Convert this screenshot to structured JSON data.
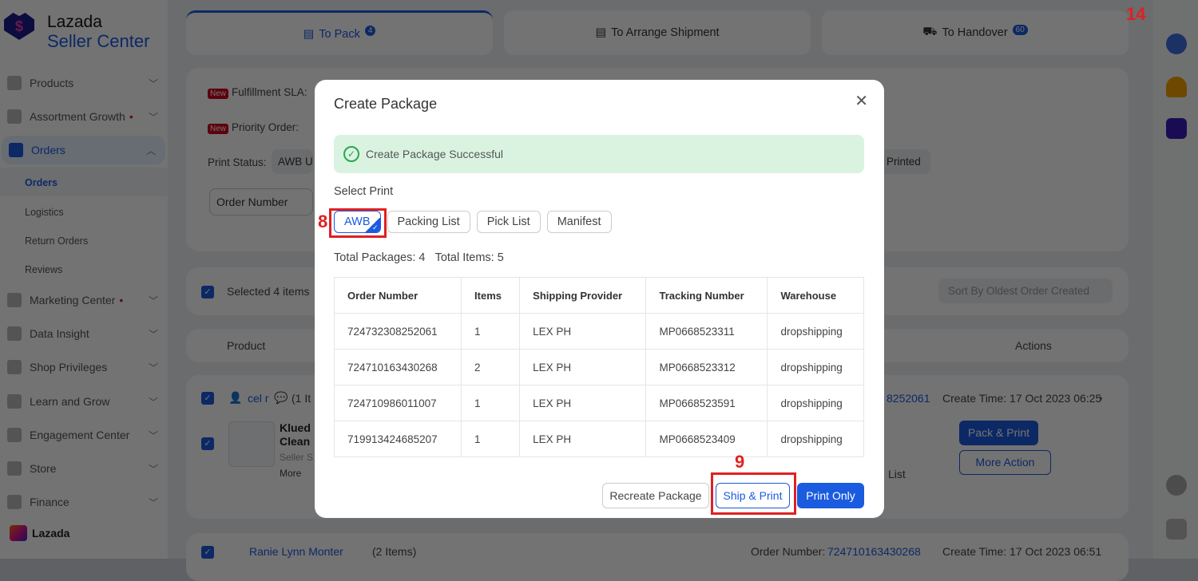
{
  "brand": {
    "line1": "Lazada",
    "line2": "Seller Center",
    "footer": "Lazada"
  },
  "sidebar": {
    "items": [
      {
        "label": "Products"
      },
      {
        "label": "Assortment Growth"
      },
      {
        "label": "Orders"
      },
      {
        "label": "Marketing Center"
      },
      {
        "label": "Data Insight"
      },
      {
        "label": "Shop Privileges"
      },
      {
        "label": "Learn and Grow"
      },
      {
        "label": "Engagement Center"
      },
      {
        "label": "Store"
      },
      {
        "label": "Finance"
      }
    ],
    "sub_items": [
      "Orders",
      "Logistics",
      "Return Orders",
      "Reviews"
    ]
  },
  "tabs": [
    {
      "label": "To Pack",
      "count": "4"
    },
    {
      "label": "To Arrange Shipment"
    },
    {
      "label": "To Handover",
      "count": "60"
    }
  ],
  "filters": {
    "new_tag": "New",
    "sla": "Fulfillment SLA:",
    "priority": "Priority Order:",
    "print_status": "Print Status:",
    "awb_chip": "AWB U",
    "printed_chip": "Printed",
    "order_number": "Order Number"
  },
  "list": {
    "selected": "Selected 4 items",
    "sort": "Sort By  Oldest Order Created",
    "col_product": "Product",
    "col_actions": "Actions",
    "order1": {
      "buyer": "cel r",
      "items": "(1 It",
      "product1": "Klued",
      "product2": "Clean",
      "seller": "Seller S",
      "more": "More",
      "order_no": "8252061",
      "create_time": "Create Time: 17 Oct 2023 06:25",
      "pack_print": "Pack & Print",
      "more_action": "More Action",
      "list_frag": "List"
    },
    "order2": {
      "buyer": "Ranie Lynn Monter",
      "items": "(2 Items)",
      "order_label": "Order Number:",
      "order_no": "724710163430268",
      "create_time": "Create Time: 17 Oct 2023 06:51"
    }
  },
  "modal": {
    "title": "Create Package",
    "success": "Create Package Successful",
    "select_print": "Select Print",
    "options": [
      "AWB",
      "Packing List",
      "Pick List",
      "Manifest"
    ],
    "total_packages": "Total Packages: 4",
    "total_items": "Total Items: 5",
    "columns": [
      "Order Number",
      "Items",
      "Shipping Provider",
      "Tracking Number",
      "Warehouse"
    ],
    "rows": [
      [
        "724732308252061",
        "1",
        "LEX PH",
        "MP0668523311",
        "dropshipping"
      ],
      [
        "724710163430268",
        "2",
        "LEX PH",
        "MP0668523312",
        "dropshipping"
      ],
      [
        "724710986011007",
        "1",
        "LEX PH",
        "MP0668523591",
        "dropshipping"
      ],
      [
        "719913424685207",
        "1",
        "LEX PH",
        "MP0668523409",
        "dropshipping"
      ]
    ],
    "recreate": "Recreate Package",
    "ship_print": "Ship & Print",
    "print_only": "Print Only"
  },
  "annotations": {
    "a8": "8",
    "a9": "9",
    "a14": "14"
  }
}
